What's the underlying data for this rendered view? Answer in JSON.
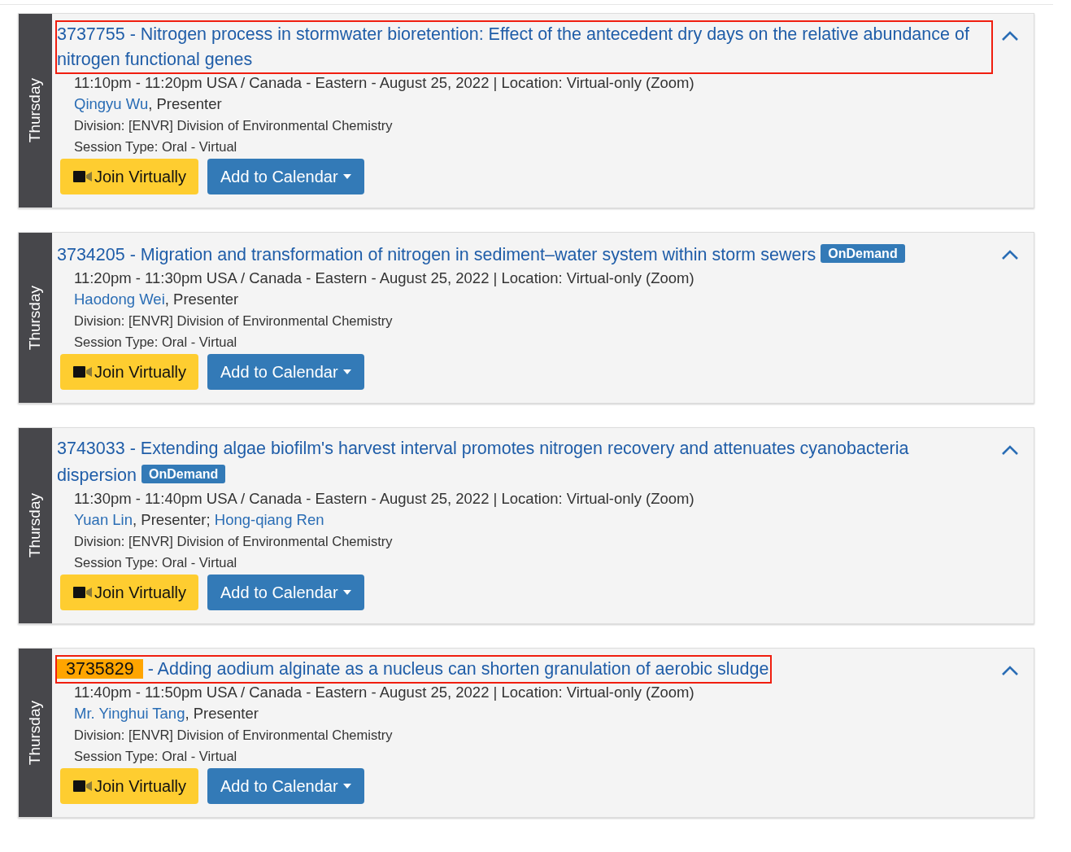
{
  "sessions": [
    {
      "day": "Thursday",
      "id": "3737755",
      "id_highlighted": false,
      "title": " - Nitrogen process in stormwater bioretention: Effect of the antecedent dry days on the relative abundance of nitrogen functional genes",
      "annotated": true,
      "expanded": true,
      "time": "11:10pm - 11:20pm USA / Canada - Eastern - August 25, 2022 | Location: Virtual-only (Zoom)",
      "presenters": [
        {
          "name": "Qingyu Wu",
          "suffix": ", Presenter"
        }
      ],
      "division": "Division: [ENVR] Division of Environmental Chemistry",
      "session_type": "Session Type: Oral - Virtual",
      "buttons": {
        "join": "Join Virtually",
        "calendar": "Add to Calendar"
      }
    },
    {
      "day": "Thursday",
      "id": "3734205",
      "id_highlighted": false,
      "title": " - Migration and transformation of nitrogen in sediment–water system within storm sewers",
      "annotated": false,
      "badge": "OnDemand",
      "expanded": true,
      "time": "11:20pm - 11:30pm USA / Canada - Eastern - August 25, 2022 | Location: Virtual-only (Zoom)",
      "presenters": [
        {
          "name": "Haodong Wei",
          "suffix": ", Presenter"
        }
      ],
      "division": "Division: [ENVR] Division of Environmental Chemistry",
      "session_type": "Session Type: Oral - Virtual",
      "buttons": {
        "join": "Join Virtually",
        "calendar": "Add to Calendar"
      }
    },
    {
      "day": "Thursday",
      "id": "3743033",
      "id_highlighted": false,
      "title": " - Extending algae biofilm's harvest interval promotes nitrogen recovery and attenuates cyanobacteria dispersion",
      "annotated": false,
      "badge": "OnDemand",
      "expanded": true,
      "time": "11:30pm - 11:40pm USA / Canada - Eastern - August 25, 2022 | Location: Virtual-only (Zoom)",
      "presenters": [
        {
          "name": "Yuan Lin",
          "suffix": ", Presenter; "
        },
        {
          "name": "Hong-qiang Ren"
        }
      ],
      "division": "Division: [ENVR] Division of Environmental Chemistry",
      "session_type": "Session Type: Oral - Virtual",
      "buttons": {
        "join": "Join Virtually",
        "calendar": "Add to Calendar"
      }
    },
    {
      "day": "Thursday",
      "id": "3735829",
      "id_highlighted": true,
      "title": " - Adding aodium alginate as a nucleus can shorten granulation of aerobic sludge",
      "annotated": true,
      "expanded": true,
      "time": "11:40pm - 11:50pm USA / Canada - Eastern - August 25, 2022 | Location: Virtual-only (Zoom)",
      "presenters": [
        {
          "name": "Mr. Yinghui Tang",
          "suffix": ", Presenter"
        }
      ],
      "division": "Division: [ENVR] Division of Environmental Chemistry",
      "session_type": "Session Type: Oral - Virtual",
      "buttons": {
        "join": "Join Virtually",
        "calendar": "Add to Calendar"
      }
    }
  ]
}
